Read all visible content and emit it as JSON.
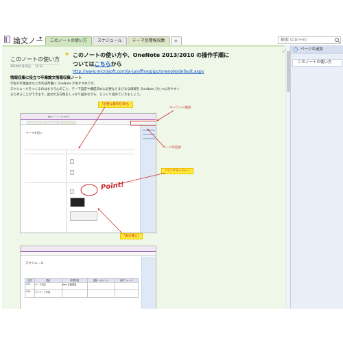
{
  "header": {
    "notebook_title": "論文ノート",
    "dropdown_arrow": "▾",
    "tabs": [
      {
        "label": "このノートの使い方",
        "active": true
      },
      {
        "label": "スケジュール",
        "active": false
      },
      {
        "label": "テーマ別情報収集",
        "active": false
      },
      {
        "label": "+",
        "active": false
      }
    ],
    "search_placeholder": "検索 (Ctrl+E)"
  },
  "page": {
    "title": "このノートの使い方",
    "date": "2014年1月16日",
    "time": "11:32",
    "heading_line1": "このノートの使い方や、OneNote 2013/2010 の操作手順に",
    "heading_line2_prefix": "ついては",
    "heading_link": "こちら",
    "heading_line2_suffix": "から",
    "url": "http://www.microsoft.com/ja-jp/office/pipc/onenote/default.aspx",
    "section_heading": "情報収集に役立つ卒業論文情報収集ノート",
    "paragraph_1": "学生の卒業論文などの作成準備に OneNote がおすすめです。",
    "paragraph_2": "スケジュールをつくるのはもちろんのこと、テーマ設定や構成決めに必要なさまざまな情報を OneNote ひとつに見やすく",
    "paragraph_3": "まとめることができます。論文の方向性をしっかり固めながら、じっくり進めていきましょう。"
  },
  "screenshot_1": {
    "page_title": "テーマを記入",
    "titlebar_text": "論文ノート - OneNote"
  },
  "screenshot_2": {
    "page_title": "スケジュール",
    "table_headers": [
      "日付",
      "項目",
      "作業内容",
      "進捗・ポイント",
      "添付ファイル"
    ],
    "table_rows": [
      [
        "11/2",
        "テーマ決定",
        "Web 文献調査",
        "",
        ""
      ],
      [
        "11/8",
        "アンケート作成",
        "",
        "",
        ""
      ]
    ]
  },
  "callouts": {
    "attach_files": "「必要な資料を添付」",
    "keyword_search": "キーワード検索",
    "add_page": "ページの追加",
    "pen_marker": "「ペンやマーカー」",
    "insert_table": "「表の挿入」",
    "point": "Point!"
  },
  "right_pane": {
    "add_page_label": "ページの追加",
    "page_items": [
      "このノートの使い方"
    ]
  },
  "colors": {
    "page_background": "#eef7e8",
    "active_tab": "#cfe6c1",
    "link": "#1155cc",
    "callout_yellow": "#ffeb3b",
    "callout_red": "#d32f2f",
    "right_pane": "#e9eef7"
  }
}
